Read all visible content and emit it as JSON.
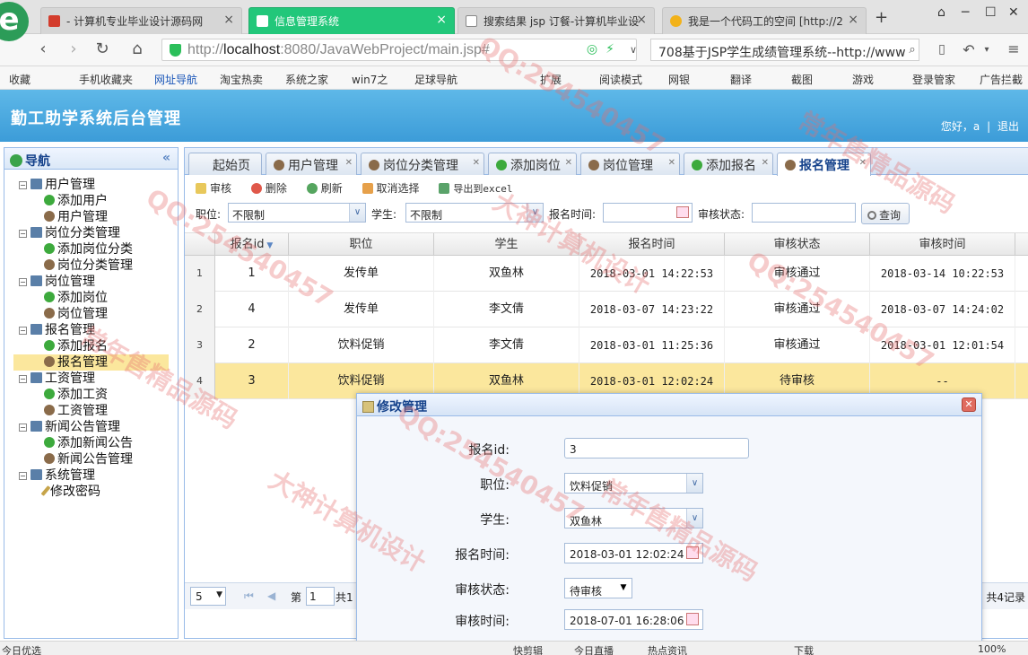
{
  "browser": {
    "tabs": [
      {
        "label": "- 计算机专业毕业设计源码网",
        "color": "#d33c2c"
      },
      {
        "label": "信息管理系统",
        "color": "#ffffff",
        "active": true
      },
      {
        "label": "搜索结果 jsp 订餐-计算机毕业设",
        "color": "#888888"
      },
      {
        "label": "我是一个代码工的空间 [http://2",
        "color": "#f2b21a"
      }
    ],
    "new_tab": "+",
    "url_prefix": "http://",
    "url_host": "localhost",
    "url_rest": ":8080/JavaWebProject/main.jsp#",
    "search_text": "708基于JSP学生成绩管理系统--http://www",
    "bookmarks": [
      "收藏",
      "手机收藏夹",
      "网址导航",
      "淘宝热卖",
      "系统之家",
      "win7之",
      "足球导航",
      "扩展",
      "阅读模式",
      "网银",
      "翻译",
      "截图",
      "游戏",
      "登录管家",
      "广告拦截"
    ]
  },
  "app": {
    "title": "勤工助学系统后台管理",
    "greeting": "您好，a",
    "logout": "退出"
  },
  "nav": {
    "title": "导航",
    "collapse": "«",
    "groups": [
      {
        "label": "用户管理",
        "children": [
          {
            "label": "添加用户",
            "icon": "add"
          },
          {
            "label": "用户管理",
            "icon": "user"
          }
        ]
      },
      {
        "label": "岗位分类管理",
        "children": [
          {
            "label": "添加岗位分类",
            "icon": "add"
          },
          {
            "label": "岗位分类管理",
            "icon": "user"
          }
        ]
      },
      {
        "label": "岗位管理",
        "children": [
          {
            "label": "添加岗位",
            "icon": "add"
          },
          {
            "label": "岗位管理",
            "icon": "user"
          }
        ]
      },
      {
        "label": "报名管理",
        "children": [
          {
            "label": "添加报名",
            "icon": "add"
          },
          {
            "label": "报名管理",
            "icon": "user",
            "selected": true
          }
        ]
      },
      {
        "label": "工资管理",
        "children": [
          {
            "label": "添加工资",
            "icon": "add"
          },
          {
            "label": "工资管理",
            "icon": "user"
          }
        ]
      },
      {
        "label": "新闻公告管理",
        "children": [
          {
            "label": "添加新闻公告",
            "icon": "add"
          },
          {
            "label": "新闻公告管理",
            "icon": "user"
          }
        ]
      },
      {
        "label": "系统管理",
        "children": [
          {
            "label": "修改密码",
            "icon": "pen"
          }
        ]
      }
    ]
  },
  "page_tabs": [
    {
      "label": "起始页",
      "icon": "",
      "closable": false
    },
    {
      "label": "用户管理",
      "icon": "user",
      "closable": true
    },
    {
      "label": "岗位分类管理",
      "icon": "user",
      "closable": true
    },
    {
      "label": "添加岗位",
      "icon": "add",
      "closable": true
    },
    {
      "label": "岗位管理",
      "icon": "user",
      "closable": true
    },
    {
      "label": "添加报名",
      "icon": "add",
      "closable": true
    },
    {
      "label": "报名管理",
      "icon": "user",
      "closable": true,
      "active": true
    }
  ],
  "toolbar": {
    "audit": "审核",
    "delete": "删除",
    "refresh": "刷新",
    "deselect": "取消选择",
    "export": "导出到excel"
  },
  "filter": {
    "position_label": "职位:",
    "position_value": "不限制",
    "student_label": "学生:",
    "student_value": "不限制",
    "time_label": "报名时间:",
    "status_label": "审核状态:",
    "query": "查询"
  },
  "grid": {
    "columns": [
      "报名id",
      "职位",
      "学生",
      "报名时间",
      "审核状态",
      "审核时间"
    ],
    "rows": [
      {
        "num": "1",
        "id": "1",
        "position": "发传单",
        "student": "双鱼林",
        "time": "2018-03-01 14:22:53",
        "status": "审核通过",
        "audit_time": "2018-03-14 10:22:53"
      },
      {
        "num": "2",
        "id": "4",
        "position": "发传单",
        "student": "李文倩",
        "time": "2018-03-07 14:23:22",
        "status": "审核通过",
        "audit_time": "2018-03-07 14:24:02"
      },
      {
        "num": "3",
        "id": "2",
        "position": "饮料促销",
        "student": "李文倩",
        "time": "2018-03-01 11:25:36",
        "status": "审核通过",
        "audit_time": "2018-03-01 12:01:54"
      },
      {
        "num": "4",
        "id": "3",
        "position": "饮料促销",
        "student": "双鱼林",
        "time": "2018-03-01 12:02:24",
        "status": "待审核",
        "audit_time": "--",
        "highlight": true
      }
    ]
  },
  "pager": {
    "page_size": "5",
    "page_label": "第",
    "page_value": "1",
    "total_prefix": "共1",
    "records": "共4记录"
  },
  "dialog": {
    "title": "修改管理",
    "close": "✕",
    "fields": [
      {
        "label": "报名id:",
        "value": "3",
        "kind": "text"
      },
      {
        "label": "职位:",
        "value": "饮料促销",
        "kind": "combo"
      },
      {
        "label": "学生:",
        "value": "双鱼林",
        "kind": "combo"
      },
      {
        "label": "报名时间:",
        "value": "2018-03-01 12:02:24",
        "kind": "date"
      },
      {
        "label": "审核状态:",
        "value": "待审核",
        "kind": "select"
      },
      {
        "label": "审核时间:",
        "value": "2018-07-01 16:28:06",
        "kind": "date"
      }
    ]
  },
  "statusbar": {
    "left": "今日优选",
    "items": [
      "快剪辑",
      "今日直播",
      "热点资讯",
      "下载",
      "100%"
    ]
  },
  "watermarks": [
    "常年售精品源码",
    "QQ:254540457",
    "大神计算机设计"
  ]
}
